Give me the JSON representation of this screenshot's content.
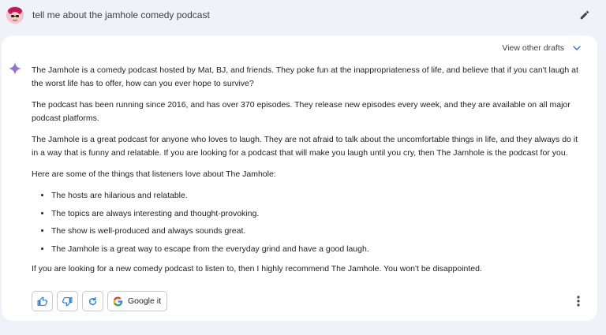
{
  "prompt": {
    "text": "tell me about the jamhole comedy podcast",
    "avatar_icon": "user-avatar",
    "edit_icon": "pencil-icon"
  },
  "response": {
    "view_drafts_label": "View other drafts",
    "paragraphs": [
      "The Jamhole is a comedy podcast hosted by Mat, BJ, and friends. They poke fun at the inappropriateness of life, and believe that if you can't laugh at the worst life has to offer, how can you ever hope to survive?",
      "The podcast has been running since 2016, and has over 370 episodes. They release new episodes every week, and they are available on all major podcast platforms.",
      "The Jamhole is a great podcast for anyone who loves to laugh. They are not afraid to talk about the uncomfortable things in life, and they always do it in a way that is funny and relatable. If you are looking for a podcast that will make you laugh until you cry, then The Jamhole is the podcast for you.",
      "Here are some of the things that listeners love about The Jamhole:"
    ],
    "bullets": [
      "The hosts are hilarious and relatable.",
      "The topics are always interesting and thought-provoking.",
      "The show is well-produced and always sounds great.",
      "The Jamhole is a great way to escape from the everyday grind and have a good laugh."
    ],
    "closing": "If you are looking for a new comedy podcast to listen to, then I highly recommend The Jamhole. You won't be disappointed."
  },
  "actions": {
    "google_it_label": "Google it",
    "icons": [
      "thumbs-up-icon",
      "thumbs-down-icon",
      "regenerate-icon",
      "google-icon",
      "more-vert-icon"
    ]
  },
  "colors": {
    "page_bg": "#f0f2f9",
    "card_bg": "#ffffff",
    "accent_blue": "#1a73e8"
  }
}
